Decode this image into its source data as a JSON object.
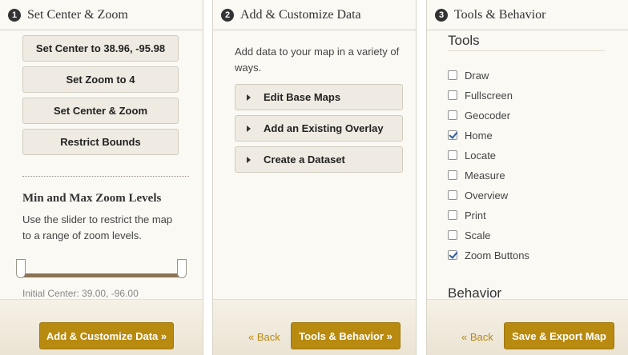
{
  "panel1": {
    "step": "1",
    "title": "Set Center & Zoom",
    "buttons": {
      "set_center": "Set Center to 38.96, -95.98",
      "set_zoom": "Set Zoom to 4",
      "set_center_zoom": "Set Center & Zoom",
      "restrict_bounds": "Restrict Bounds"
    },
    "zoom_section": {
      "title": "Min and Max Zoom Levels",
      "description_line1": "Use the slider to restrict the map",
      "description_line2": "to a range of zoom levels."
    },
    "initial_center": "Initial Center: 39.00, -96.00",
    "next_button": "Add & Customize Data »"
  },
  "panel2": {
    "step": "2",
    "title": "Add & Customize Data",
    "intro_line1": "Add data to your map in a variety of",
    "intro_line2": "ways.",
    "options": {
      "edit_base_maps": "Edit Base Maps",
      "add_overlay": "Add an Existing Overlay",
      "create_dataset": "Create a Dataset"
    },
    "back_link": "« Back",
    "next_button": "Tools & Behavior »"
  },
  "panel3": {
    "step": "3",
    "title": "Tools & Behavior",
    "tools_heading": "Tools",
    "tools": [
      {
        "label": "Draw",
        "checked": false
      },
      {
        "label": "Fullscreen",
        "checked": false
      },
      {
        "label": "Geocoder",
        "checked": false
      },
      {
        "label": "Home",
        "checked": true
      },
      {
        "label": "Locate",
        "checked": false
      },
      {
        "label": "Measure",
        "checked": false
      },
      {
        "label": "Overview",
        "checked": false
      },
      {
        "label": "Print",
        "checked": false
      },
      {
        "label": "Scale",
        "checked": false
      },
      {
        "label": "Zoom Buttons",
        "checked": true
      }
    ],
    "behavior_heading": "Behavior",
    "back_link": "« Back",
    "next_button": "Save & Export Map"
  },
  "colors": {
    "accent": "#b88a10",
    "panel_bg": "#fbf9f4",
    "slider_track": "#8b7355"
  }
}
